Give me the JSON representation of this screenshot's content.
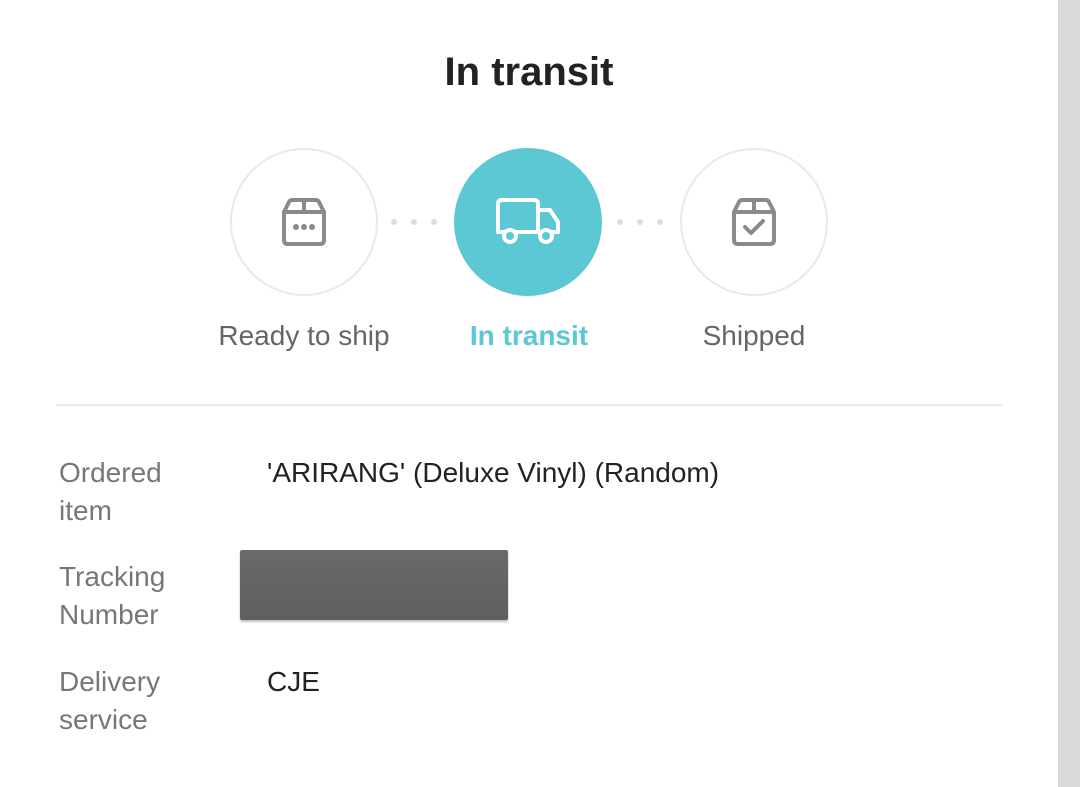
{
  "header": {
    "title": "In transit"
  },
  "steps": [
    {
      "label": "Ready to ship",
      "icon": "box-dots-icon",
      "active": false
    },
    {
      "label": "In transit",
      "icon": "truck-icon",
      "active": true
    },
    {
      "label": "Shipped",
      "icon": "box-check-icon",
      "active": false
    }
  ],
  "colors": {
    "accent": "#5cc8d4",
    "inactive_icon": "#8a8a8a",
    "label": "#777777"
  },
  "details": {
    "ordered_item": {
      "label_line1": "Ordered",
      "label_line2": "item",
      "value": "'ARIRANG' (Deluxe Vinyl) (Random)"
    },
    "tracking_number": {
      "label_line1": "Tracking",
      "label_line2": "Number"
    },
    "delivery_service": {
      "label_line1": "Delivery",
      "label_line2": "service",
      "value": "CJE"
    }
  }
}
